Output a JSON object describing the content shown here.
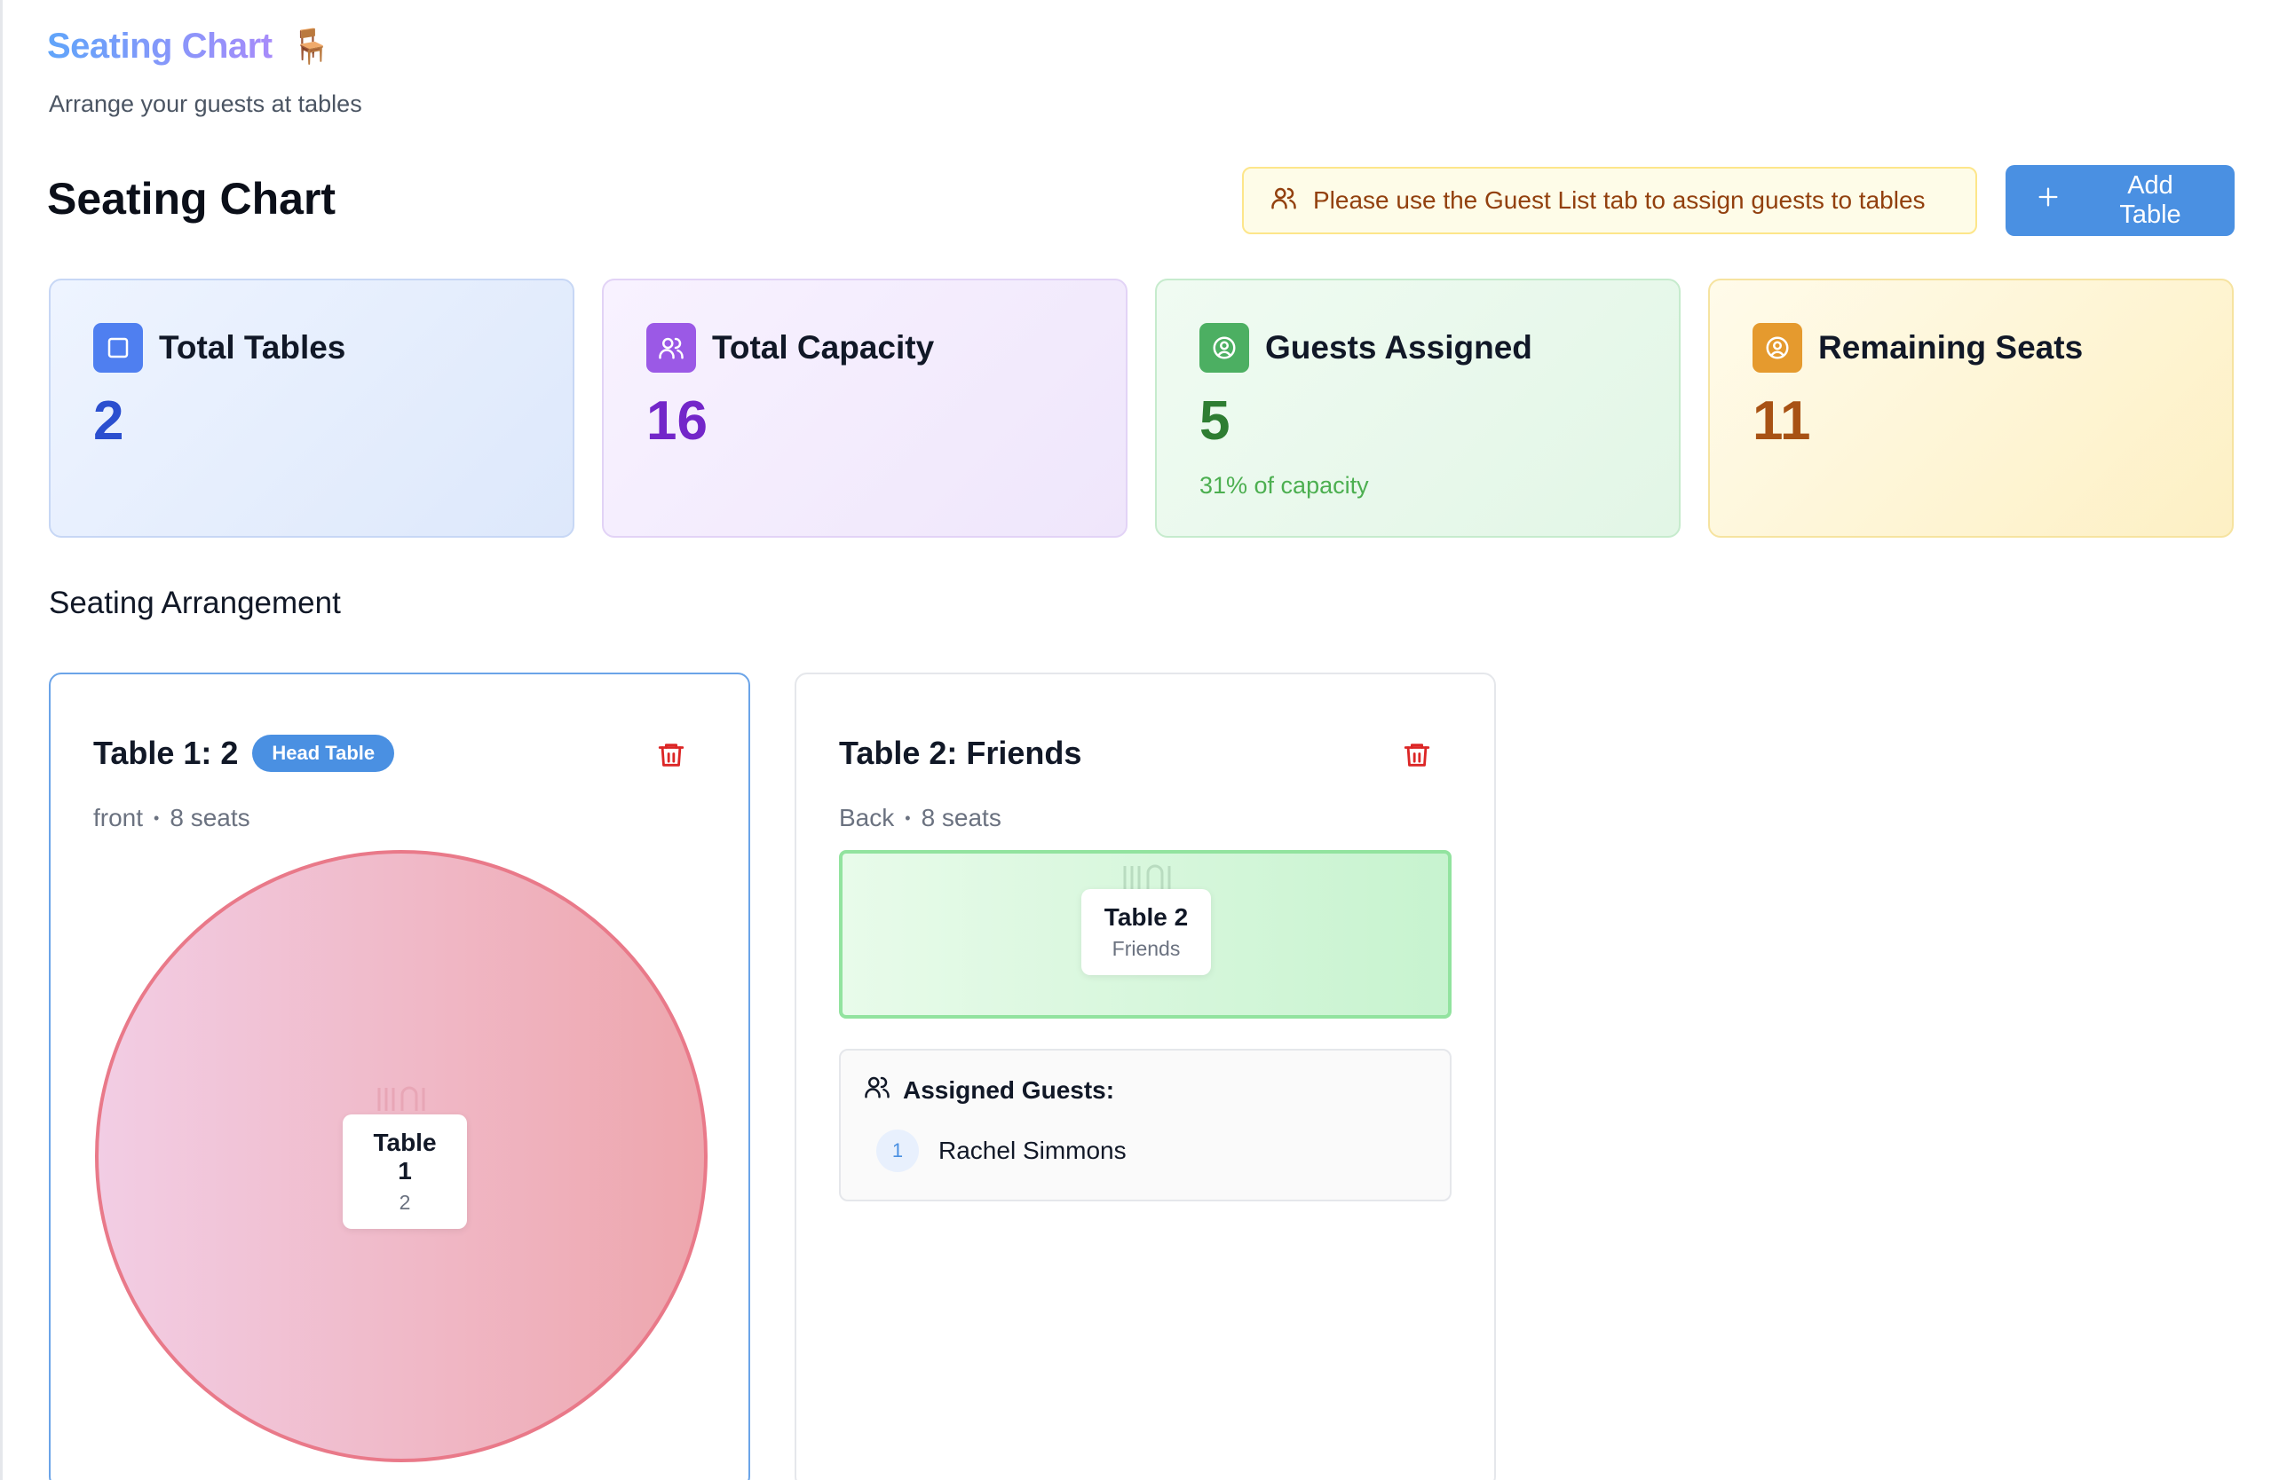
{
  "app": {
    "title": "Seating Chart",
    "emoji": "🪑",
    "subtitle": "Arrange your guests at tables"
  },
  "header": {
    "section_title": "Seating Chart",
    "notice": "Please use the Guest List tab to assign guests to tables",
    "add_button": "Add Table"
  },
  "stats": [
    {
      "label": "Total Tables",
      "value": "2",
      "icon": "square-icon"
    },
    {
      "label": "Total Capacity",
      "value": "16",
      "icon": "users-icon"
    },
    {
      "label": "Guests Assigned",
      "value": "5",
      "note": "31% of capacity",
      "icon": "user-circle-icon"
    },
    {
      "label": "Remaining Seats",
      "value": "11",
      "icon": "user-circle-icon"
    }
  ],
  "arrangement_title": "Seating Arrangement",
  "tables": [
    {
      "title": "Table 1: 2",
      "badge": "Head Table",
      "location": "front",
      "sep": "•",
      "seats": "8 seats",
      "shape": "round",
      "plate_name": "Table 1",
      "plate_sub": "2"
    },
    {
      "title": "Table 2: Friends",
      "location": "Back",
      "sep": "•",
      "seats": "8 seats",
      "shape": "rectangle",
      "plate_name": "Table 2",
      "plate_sub": "Friends",
      "assigned_label": "Assigned Guests:",
      "guests": [
        {
          "num": "1",
          "name": "Rachel Simmons"
        }
      ]
    }
  ],
  "colors": {
    "accent": "#4a90e2",
    "delete": "#dc2626"
  }
}
